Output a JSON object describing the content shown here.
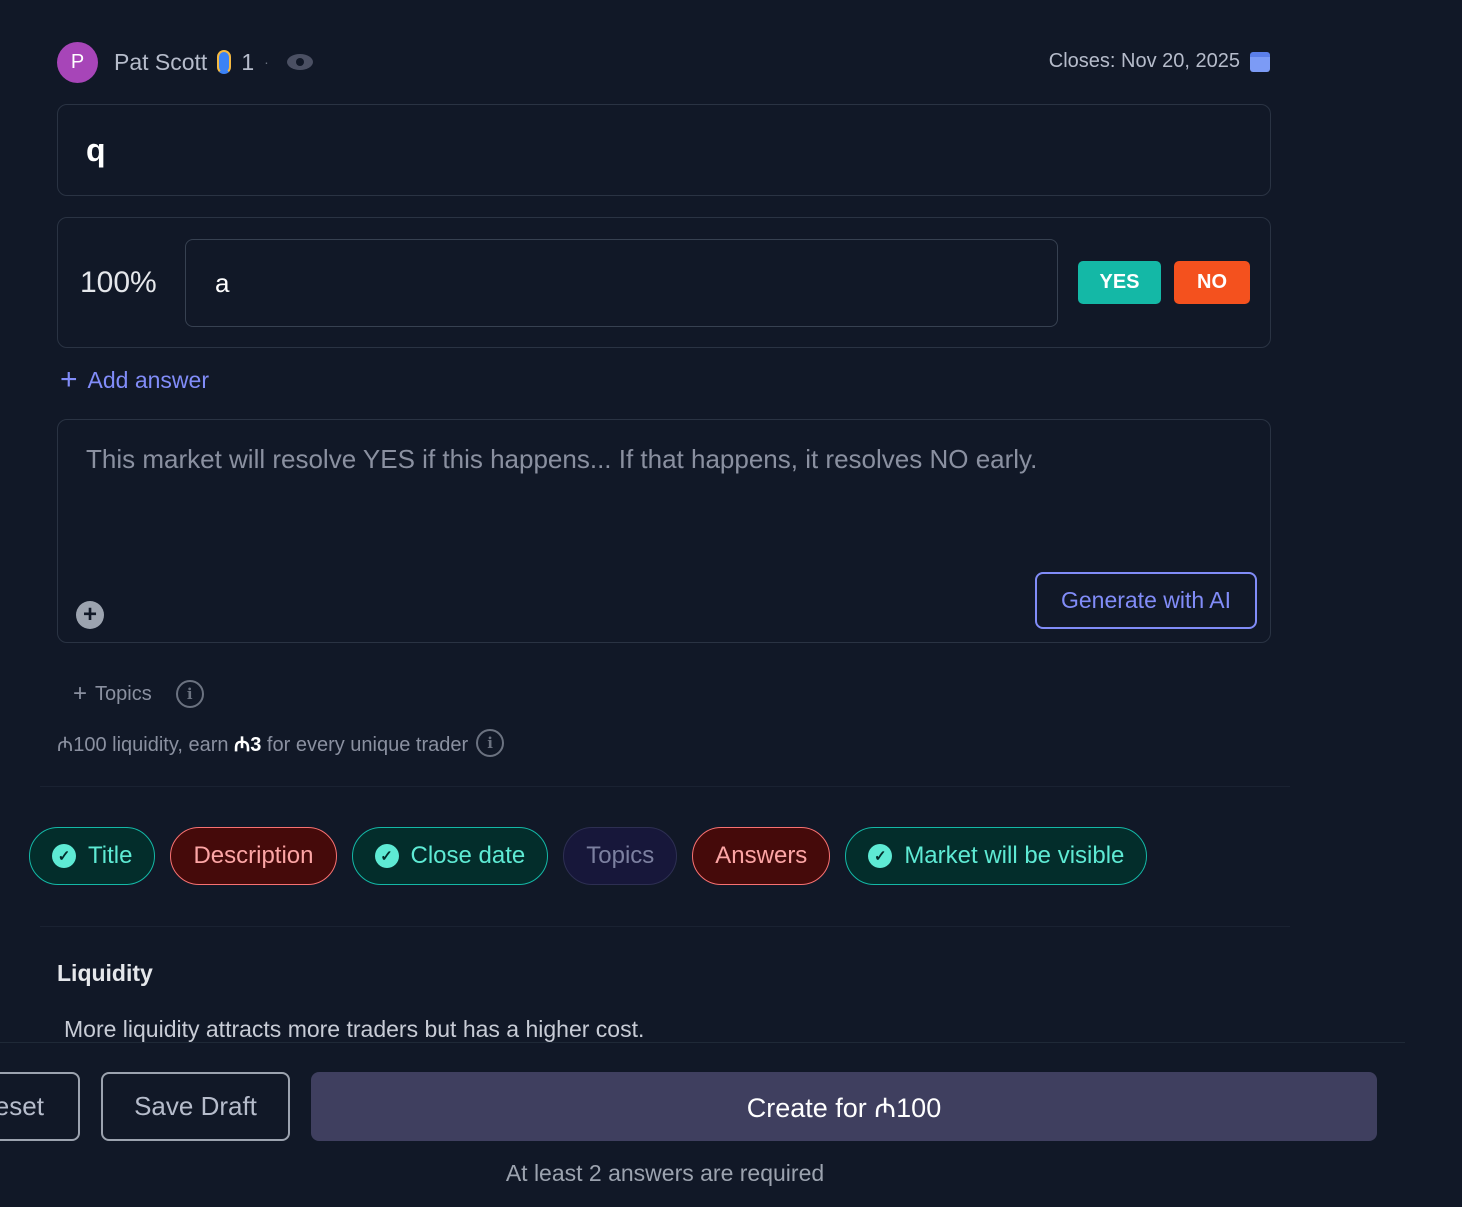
{
  "header": {
    "avatar_letter": "P",
    "user_name": "Pat Scott",
    "streak_icon": "flip-flop-icon",
    "streak_count": "1",
    "separator": "·",
    "closes": "Closes: Nov 20, 2025"
  },
  "question": {
    "value": "q"
  },
  "answers": [
    {
      "probability": "100%",
      "text": "a",
      "yes_label": "YES",
      "no_label": "NO"
    }
  ],
  "add_answer": "Add answer",
  "description": {
    "placeholder": "This market will resolve YES if this happens... If that happens, it resolves NO early.",
    "generate_label": "Generate with AI"
  },
  "topics_label": "Topics",
  "liquidity_note": {
    "prefix": "₼100 liquidity, earn ",
    "bonus": "₼3",
    "suffix": " for every unique trader"
  },
  "checklist": [
    {
      "label": "Title",
      "status": "ok"
    },
    {
      "label": "Description",
      "status": "error"
    },
    {
      "label": "Close date",
      "status": "ok"
    },
    {
      "label": "Topics",
      "status": "neutral"
    },
    {
      "label": "Answers",
      "status": "error"
    },
    {
      "label": "Market will be visible",
      "status": "ok"
    }
  ],
  "liquidity": {
    "heading": "Liquidity",
    "text": "More liquidity attracts more traders but has a higher cost."
  },
  "footer": {
    "reset": "Reset",
    "save_draft": "Save Draft",
    "create": "Create for ₼100",
    "requirement": "At least 2 answers are required"
  },
  "colors": {
    "accent": "#818cf8",
    "yes": "#14b8a6",
    "no": "#f4511e",
    "ok": "#5eead4",
    "error": "#fca5a5"
  }
}
